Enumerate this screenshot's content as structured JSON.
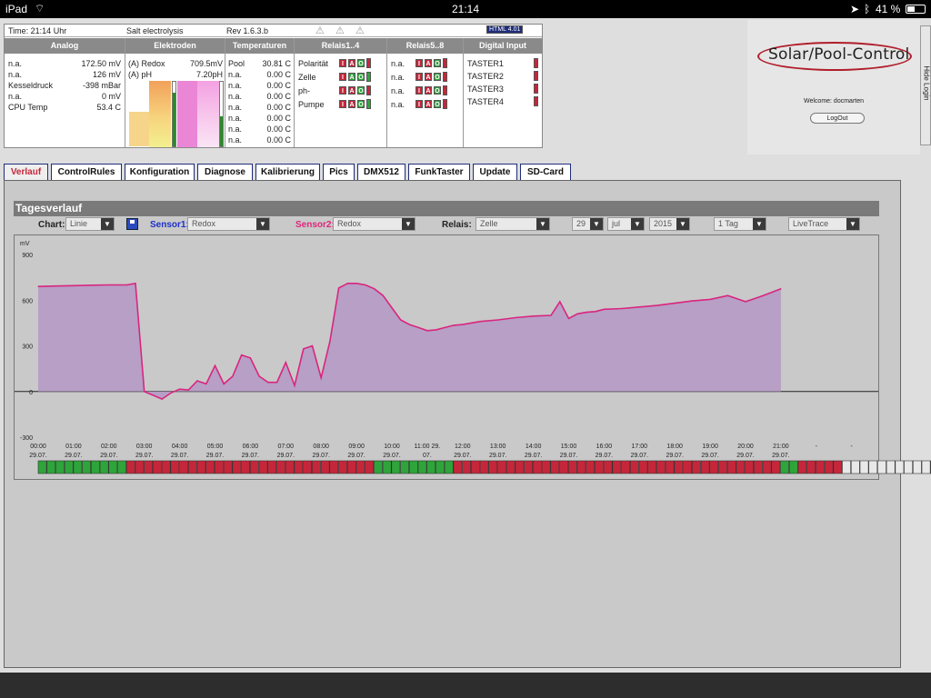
{
  "status_bar": {
    "device": "iPad",
    "time": "21:14",
    "battery": "41 %"
  },
  "topline": {
    "time": "Time: 21:14 Uhr",
    "mode": "Salt electrolysis",
    "rev": "Rev 1.6.3.b",
    "badge": "HTML 4.01"
  },
  "headers": [
    "Analog",
    "Elektroden",
    "Temperaturen",
    "Relais1..4",
    "Relais5..8",
    "Digital Input"
  ],
  "analog": [
    [
      "n.a.",
      "172.50 mV"
    ],
    [
      "n.a.",
      "126 mV"
    ],
    [
      "Kesseldruck",
      "-398 mBar"
    ],
    [
      "n.a.",
      "0 mV"
    ],
    [
      "CPU Temp",
      "53.4 C"
    ]
  ],
  "electrodes": [
    [
      "(A) Redox",
      "709.5mV"
    ],
    [
      "(A) pH",
      "7.20pH"
    ]
  ],
  "temperatures": [
    [
      "Pool",
      "30.81 C"
    ],
    [
      "n.a.",
      "0.00 C"
    ],
    [
      "n.a.",
      "0.00 C"
    ],
    [
      "n.a.",
      "0.00 C"
    ],
    [
      "n.a.",
      "0.00 C"
    ],
    [
      "n.a.",
      "0.00 C"
    ],
    [
      "n.a.",
      "0.00 C"
    ],
    [
      "n.a.",
      "0.00 C"
    ]
  ],
  "relais1_4": [
    "Polarität",
    "Zelle",
    "ph-",
    "Pumpe"
  ],
  "relais5_8": [
    "n.a.",
    "n.a.",
    "n.a.",
    "n.a."
  ],
  "digital": [
    "TASTER1",
    "TASTER2",
    "TASTER3",
    "TASTER4"
  ],
  "relay_letters": [
    "I",
    "A",
    "O"
  ],
  "logo": "Solar/Pool-Control",
  "welcome": "Welcome:  docmarten",
  "logout": "LogOut",
  "hide_login": "Hide Login",
  "tabs": [
    "Verlauf",
    "ControlRules",
    "Konfiguration",
    "Diagnose",
    "Kalibrierung",
    "Pics",
    "DMX512",
    "FunkTaster",
    "Update",
    "SD-Card"
  ],
  "section_title": "Tagesverlauf",
  "controls": {
    "chart_label": "Chart:",
    "chart_value": "Linie",
    "sensor1_label": "Sensor1:",
    "sensor1_value": "Redox",
    "sensor2_label": "Sensor2:",
    "sensor2_value": "Redox",
    "relais_label": "Relais:",
    "relais_value": "Zelle",
    "day": "29",
    "month": "jul",
    "year": "2015",
    "range": "1 Tag",
    "trace": "LiveTrace"
  },
  "colors": {
    "sensor1": "#1d2fc9",
    "sensor2": "#e0257a",
    "line": "#d9257f",
    "fill": "#b59ac4",
    "green": "#2ea43a",
    "red": "#c5263a"
  },
  "chart_data": {
    "type": "area",
    "ylabel": "mV",
    "ylim": [
      -300,
      900
    ],
    "yticks": [
      -300,
      0,
      300,
      600,
      900
    ],
    "xlabels": [
      [
        "00:00",
        "29.07."
      ],
      [
        "01:00",
        "29.07."
      ],
      [
        "02:00",
        "29.07."
      ],
      [
        "03:00",
        "29.07."
      ],
      [
        "04:00",
        "29.07."
      ],
      [
        "05:00",
        "29.07."
      ],
      [
        "06:00",
        "29.07."
      ],
      [
        "07:00",
        "29.07."
      ],
      [
        "08:00",
        "29.07."
      ],
      [
        "09:00",
        "29.07."
      ],
      [
        "10:00",
        "29.07."
      ],
      [
        "11:00 29.",
        "07."
      ],
      [
        "12:00",
        "29.07."
      ],
      [
        "13:00",
        "29.07."
      ],
      [
        "14:00",
        "29.07."
      ],
      [
        "15:00",
        "29.07."
      ],
      [
        "16:00",
        "29.07."
      ],
      [
        "17:00",
        "29.07."
      ],
      [
        "18:00",
        "29.07."
      ],
      [
        "19:00",
        "29.07."
      ],
      [
        "20:00",
        "29.07."
      ],
      [
        "21:00",
        "29.07."
      ],
      [
        "-",
        ""
      ],
      [
        "-",
        ""
      ]
    ],
    "x": [
      0,
      0.5,
      1,
      1.5,
      2,
      2.5,
      2.75,
      3,
      3.25,
      3.5,
      3.75,
      4,
      4.25,
      4.5,
      4.75,
      5,
      5.25,
      5.5,
      5.75,
      6,
      6.25,
      6.5,
      6.75,
      7,
      7.25,
      7.5,
      7.75,
      8,
      8.25,
      8.5,
      8.75,
      9,
      9.25,
      9.5,
      9.75,
      10,
      10.25,
      10.5,
      10.75,
      11,
      11.25,
      11.5,
      11.75,
      12,
      12.5,
      13,
      13.5,
      14,
      14.5,
      14.75,
      15,
      15.25,
      15.5,
      15.75,
      16,
      16.5,
      17,
      17.5,
      18,
      18.5,
      19,
      19.5,
      20,
      20.25,
      20.5,
      21
    ],
    "values": [
      690,
      693,
      695,
      698,
      700,
      700,
      710,
      0,
      -25,
      -50,
      -10,
      15,
      10,
      70,
      50,
      170,
      50,
      100,
      240,
      220,
      100,
      60,
      60,
      190,
      40,
      280,
      300,
      90,
      330,
      680,
      710,
      710,
      700,
      675,
      630,
      550,
      470,
      440,
      420,
      400,
      405,
      420,
      435,
      440,
      460,
      470,
      485,
      495,
      500,
      590,
      480,
      510,
      520,
      525,
      540,
      545,
      555,
      565,
      580,
      595,
      605,
      630,
      590,
      610,
      630,
      675
    ]
  },
  "relay_bar": [
    "g",
    "g",
    "g",
    "g",
    "g",
    "g",
    "g",
    "g",
    "g",
    "g",
    "r",
    "r",
    "r",
    "r",
    "r",
    "r",
    "r",
    "r",
    "r",
    "r",
    "r",
    "r",
    "r",
    "r",
    "r",
    "r",
    "r",
    "r",
    "r",
    "r",
    "r",
    "r",
    "r",
    "r",
    "r",
    "r",
    "r",
    "r",
    "g",
    "g",
    "g",
    "g",
    "g",
    "g",
    "g",
    "g",
    "g",
    "r",
    "r",
    "r",
    "r",
    "r",
    "r",
    "r",
    "r",
    "r",
    "r",
    "r",
    "r",
    "r",
    "r",
    "r",
    "r",
    "r",
    "r",
    "r",
    "r",
    "r",
    "r",
    "r",
    "r",
    "r",
    "r",
    "r",
    "r",
    "r",
    "r",
    "r",
    "r",
    "r",
    "r",
    "r",
    "r",
    "r",
    "g",
    "g",
    "r",
    "r",
    "r",
    "r",
    "r",
    "w",
    "w",
    "w",
    "w",
    "w",
    "w",
    "w",
    "w",
    "w",
    "w",
    "w",
    "w"
  ]
}
